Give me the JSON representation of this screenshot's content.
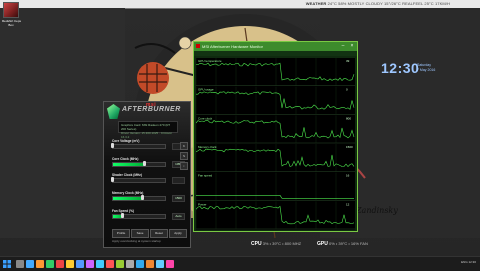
{
  "desktop": {
    "icon_label": "Redshirt Ceps Box",
    "weather_label": "WEATHER",
    "weather_text": "24°C 58% MOSTLY CLOUDY 15°/26°C REALFEEL 25°C 17KM/H",
    "clock_time": "12:30",
    "clock_date_line1": "Saturday",
    "clock_date_line2": "7 May 2016",
    "signature": "Zandinsky",
    "cpu_label": "CPU",
    "cpu_text": "3% • 39°C • 800 MHZ",
    "gpu_label": "GPU",
    "gpu_text": "0% • 39°C • 16% FAN"
  },
  "monitor": {
    "title": "MSI Afterburner Hardware Monitor",
    "graph_labels": [
      "GPU temperature",
      "GPU usage",
      "Core clock",
      "Memory clock",
      "Fan speed",
      "Power"
    ],
    "graph_values": [
      "39",
      "0",
      "800",
      "1500",
      "16",
      "12"
    ]
  },
  "afterburner": {
    "brand": "AFTERBURNER",
    "msi": "msi",
    "info_line1": "Graphics Card: MSI Radeon 270 (R7 200 Series)",
    "info_line2": "Driver Version: 15.300.1025 · Crimson 16.3.2",
    "sliders": [
      {
        "label": "Core Voltage (mV)",
        "value": "",
        "level": 0.0
      },
      {
        "label": "Core Clock (MHz)",
        "value": "1050",
        "level": 0.62
      },
      {
        "label": "Shader Clock (MHz)",
        "value": "",
        "level": 0.0
      },
      {
        "label": "Memory Clock (MHz)",
        "value": "1500",
        "level": 0.58
      },
      {
        "label": "Fan Speed (%)",
        "value": "Auto",
        "level": 0.2
      }
    ],
    "buttons": [
      "Profile",
      "Save",
      "Reset",
      "Apply"
    ],
    "footer": "Apply overclocking at system startup",
    "side_buttons": [
      "K",
      "S",
      "i"
    ]
  },
  "taskbar": {
    "tray_text": "ENG  12:30"
  }
}
